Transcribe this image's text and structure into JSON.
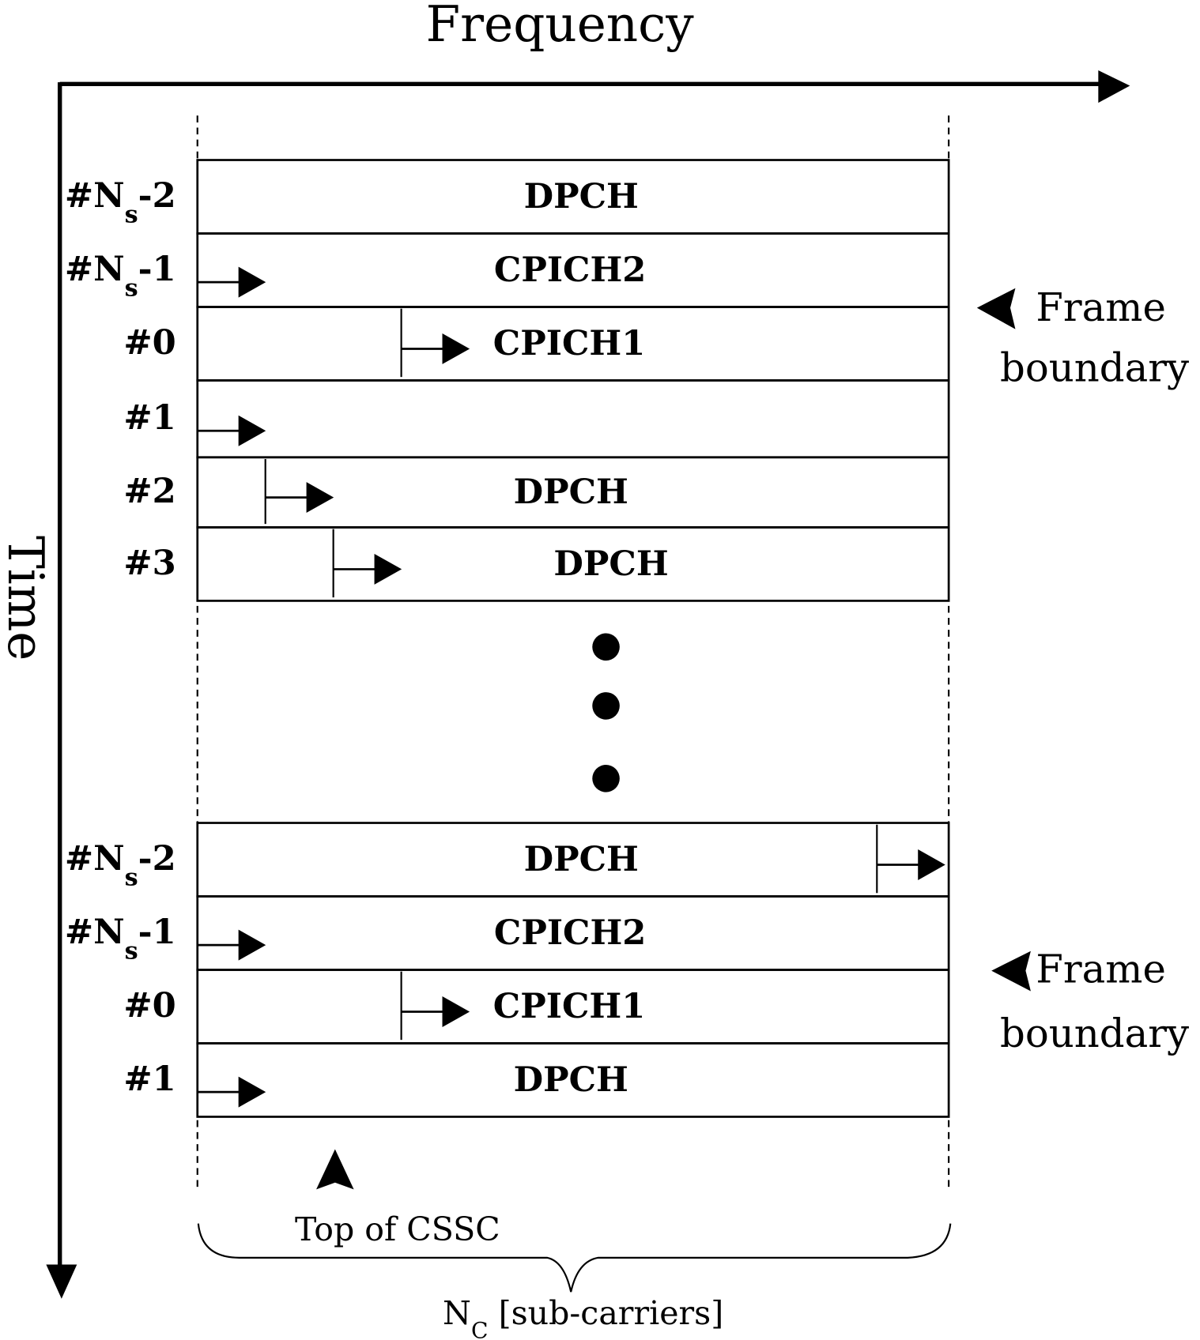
{
  "axes": {
    "x_label": "Frequency",
    "y_label": "Time"
  },
  "top_block": {
    "rows": [
      {
        "label_main": "#N",
        "label_sub": "s",
        "label_tail": "-2",
        "channel": "DPCH",
        "shift": null
      },
      {
        "label_main": "#N",
        "label_sub": "s",
        "label_tail": "-1",
        "channel": "CPICH2",
        "shift": 0
      },
      {
        "label_main": "#0",
        "label_sub": "",
        "label_tail": "",
        "channel": "CPICH1",
        "shift": 3
      },
      {
        "label_main": "#1",
        "label_sub": "",
        "label_tail": "",
        "channel": "",
        "shift": 0
      },
      {
        "label_main": "#2",
        "label_sub": "",
        "label_tail": "",
        "channel": "DPCH",
        "shift": 1
      },
      {
        "label_main": "#3",
        "label_sub": "",
        "label_tail": "",
        "channel": "DPCH",
        "shift": 2
      }
    ],
    "frame_boundary_label_1": "Frame",
    "frame_boundary_label_2": "boundary"
  },
  "bottom_block": {
    "rows": [
      {
        "label_main": "#N",
        "label_sub": "s",
        "label_tail": "-2",
        "channel": "DPCH",
        "shift": 10
      },
      {
        "label_main": "#N",
        "label_sub": "s",
        "label_tail": "-1",
        "channel": "CPICH2",
        "shift": 0
      },
      {
        "label_main": "#0",
        "label_sub": "",
        "label_tail": "",
        "channel": "CPICH1",
        "shift": 3
      },
      {
        "label_main": "#1",
        "label_sub": "",
        "label_tail": "",
        "channel": "DPCH",
        "shift": 0
      }
    ],
    "frame_boundary_label_1": "Frame",
    "frame_boundary_label_2": "boundary"
  },
  "annotations": {
    "top_of_cssc": "Top of CSSC",
    "nc_main": "N",
    "nc_sub": "C",
    "nc_tail": " [sub-carriers]"
  }
}
